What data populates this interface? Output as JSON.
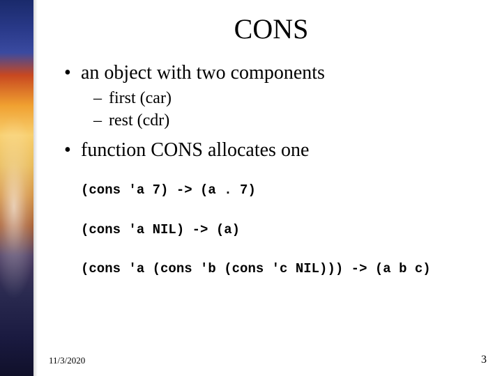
{
  "title": "CONS",
  "bullets": {
    "b1": "an object with two components",
    "b1_sub1": "first (car)",
    "b1_sub2": "rest (cdr)",
    "b2": "function CONS allocates one"
  },
  "code": {
    "line1": "(cons 'a 7) -> (a . 7)",
    "line2": "(cons 'a NIL) -> (a)",
    "line3": "(cons 'a (cons 'b (cons 'c NIL))) -> (a b c)"
  },
  "footer": {
    "date": "11/3/2020",
    "page": "3"
  }
}
